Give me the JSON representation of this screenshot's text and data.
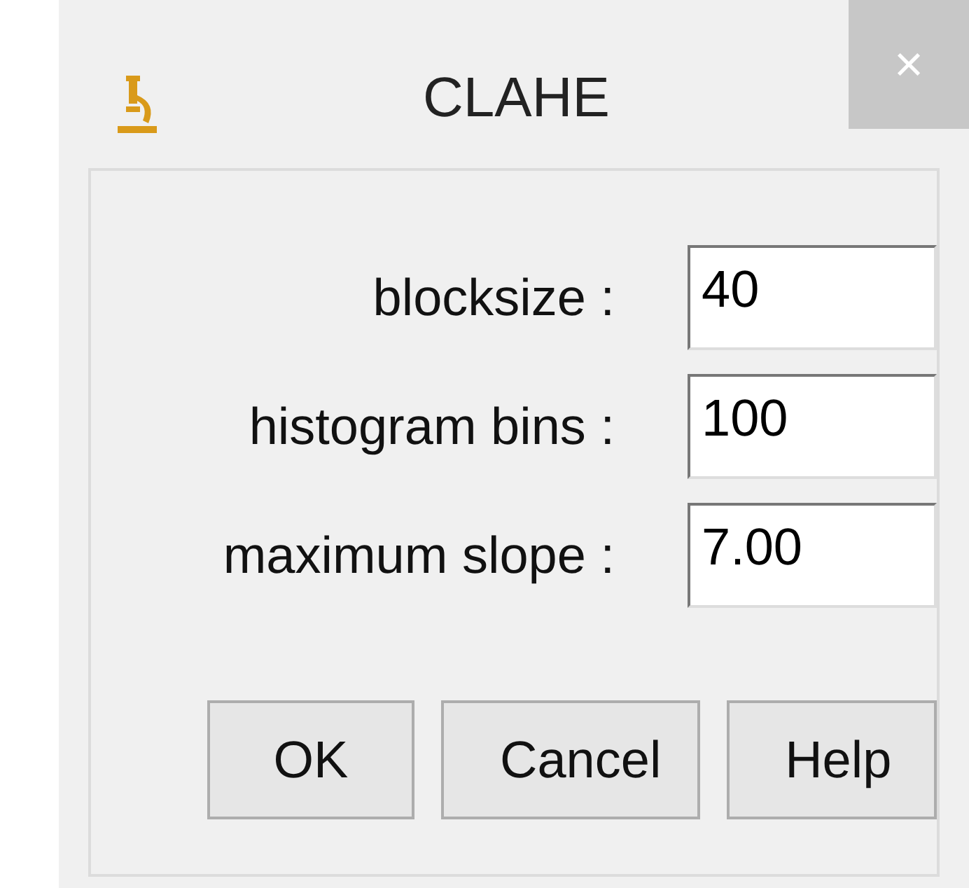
{
  "window": {
    "title": "CLAHE",
    "close": "×"
  },
  "fields": [
    {
      "label": "blocksize :",
      "value": "40"
    },
    {
      "label": "histogram bins :",
      "value": "100"
    },
    {
      "label": "maximum slope :",
      "value": "7.00"
    }
  ],
  "buttons": [
    "OK",
    "Cancel",
    "Help"
  ]
}
